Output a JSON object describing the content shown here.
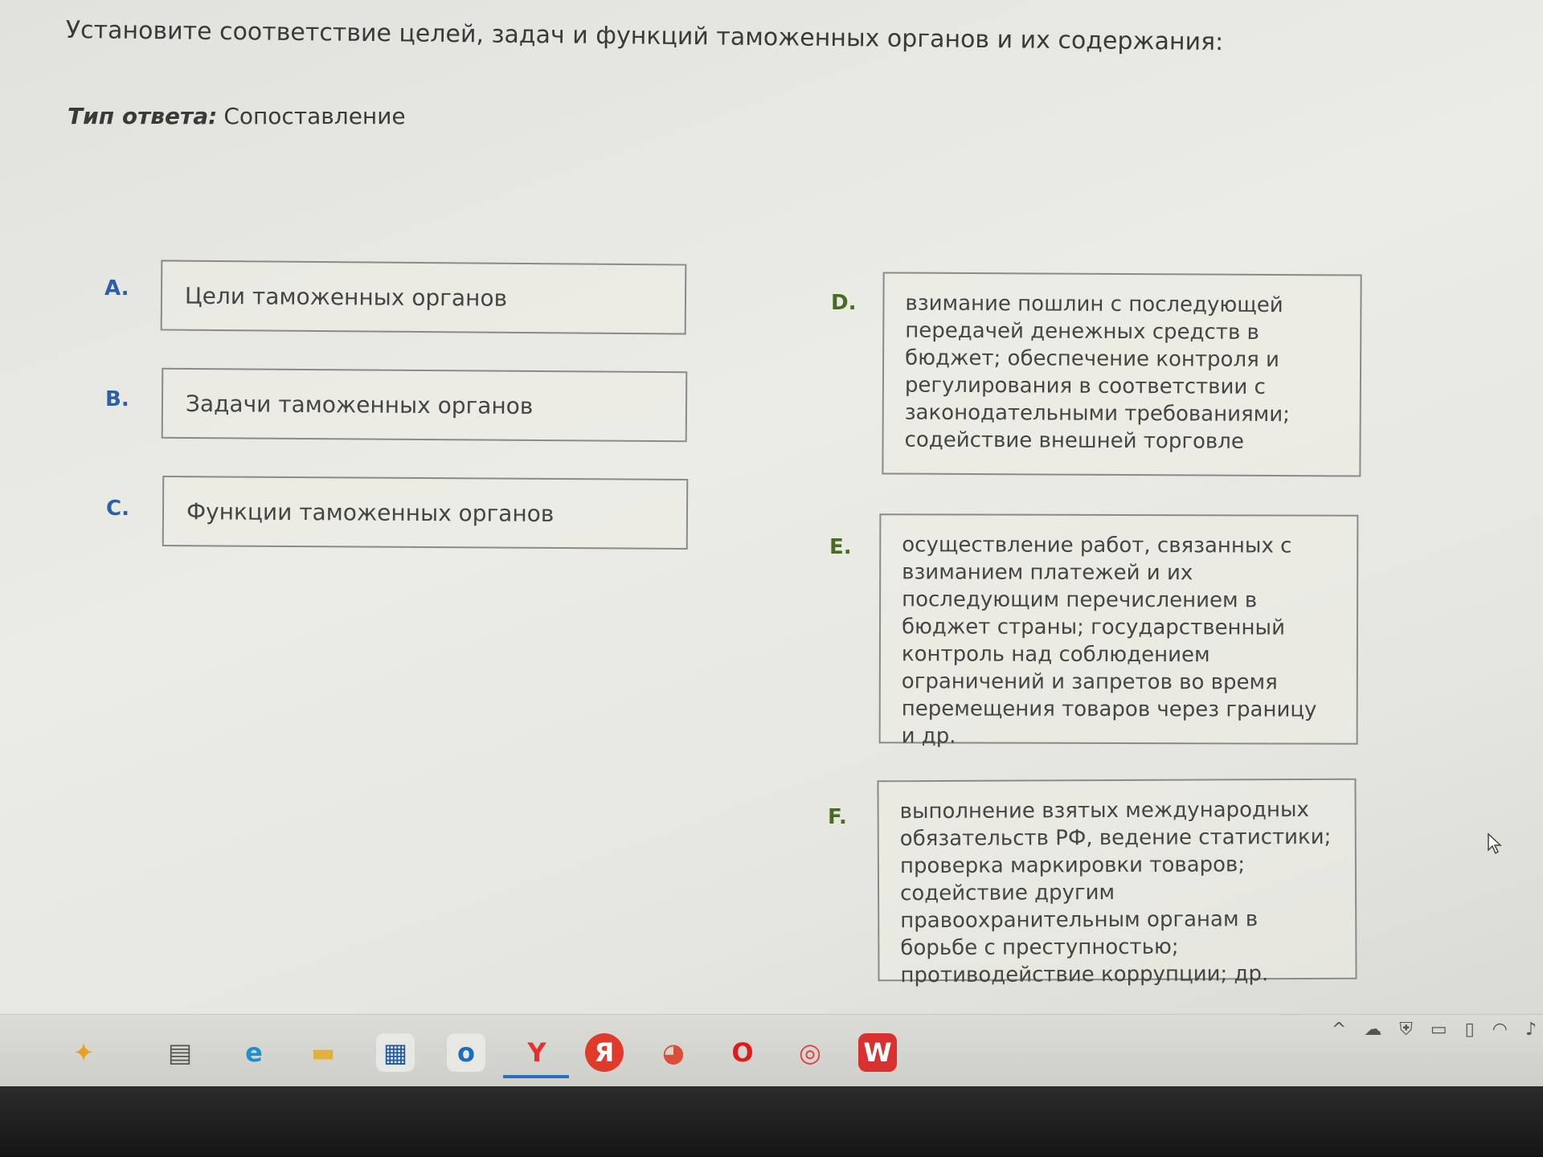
{
  "question": {
    "text": "Установите соответствие целей, задач и функций таможенных органов и их содержания:"
  },
  "answer_type": {
    "label": "Тип ответа:",
    "value": "Сопоставление"
  },
  "left_items": [
    {
      "letter": "A.",
      "text": "Цели таможенных органов"
    },
    {
      "letter": "B.",
      "text": "Задачи таможенных органов"
    },
    {
      "letter": "C.",
      "text": "Функции таможенных органов"
    }
  ],
  "right_items": [
    {
      "letter": "D.",
      "text": "взимание пошлин с последующей передачей денежных средств в бюджет; обеспечение контроля и регулирования в соответствии с законодательными требованиями; содействие внешней торговле"
    },
    {
      "letter": "E.",
      "text": "осуществление работ, связанных с взиманием платежей и их последующим перечислением в бюджет страны; государственный контроль над соблюдением ограничений и запретов во время перемещения товаров через границу и др."
    },
    {
      "letter": "F.",
      "text": "выполнение взятых международных обязательств РФ, ведение статистики; проверка маркировки товаров; содействие другим правоохранительным органам в борьбе с преступностью; противодействие коррупции; др."
    }
  ],
  "taskbar": {
    "icons": [
      {
        "name": "copilot-icon",
        "glyph": "✦",
        "color": "#e8a020"
      },
      {
        "name": "task-view-icon",
        "glyph": "▤",
        "color": "#555555"
      },
      {
        "name": "edge-icon",
        "glyph": "e",
        "color": "#1f8fd0"
      },
      {
        "name": "file-explorer-icon",
        "glyph": "▬",
        "color": "#e2b13a"
      },
      {
        "name": "store-icon",
        "glyph": "▦",
        "color": "#1d5aa8"
      },
      {
        "name": "outlook-icon",
        "glyph": "o",
        "color": "#1a6ec0"
      },
      {
        "name": "yandex-browser-icon",
        "glyph": "Y",
        "color": "#e53030"
      },
      {
        "name": "yandex-icon",
        "glyph": "Я",
        "color": "#ffffff"
      },
      {
        "name": "chrome-icon",
        "glyph": "◕",
        "color": "#dd4b39"
      },
      {
        "name": "opera-icon",
        "glyph": "O",
        "color": "#e01a1a"
      },
      {
        "name": "opera-gx-icon",
        "glyph": "◎",
        "color": "#e04040"
      },
      {
        "name": "wps-office-icon",
        "glyph": "W",
        "color": "#ffffff"
      }
    ],
    "tray_icons": [
      {
        "name": "chevron-up-icon",
        "glyph": "^"
      },
      {
        "name": "cloud-icon",
        "glyph": "☁"
      },
      {
        "name": "shield-icon",
        "glyph": "⛨"
      },
      {
        "name": "meet-now-icon",
        "glyph": "▭"
      },
      {
        "name": "battery-icon",
        "glyph": "▯"
      },
      {
        "name": "wifi-icon",
        "glyph": "◠"
      },
      {
        "name": "volume-icon",
        "glyph": "♪"
      }
    ]
  }
}
